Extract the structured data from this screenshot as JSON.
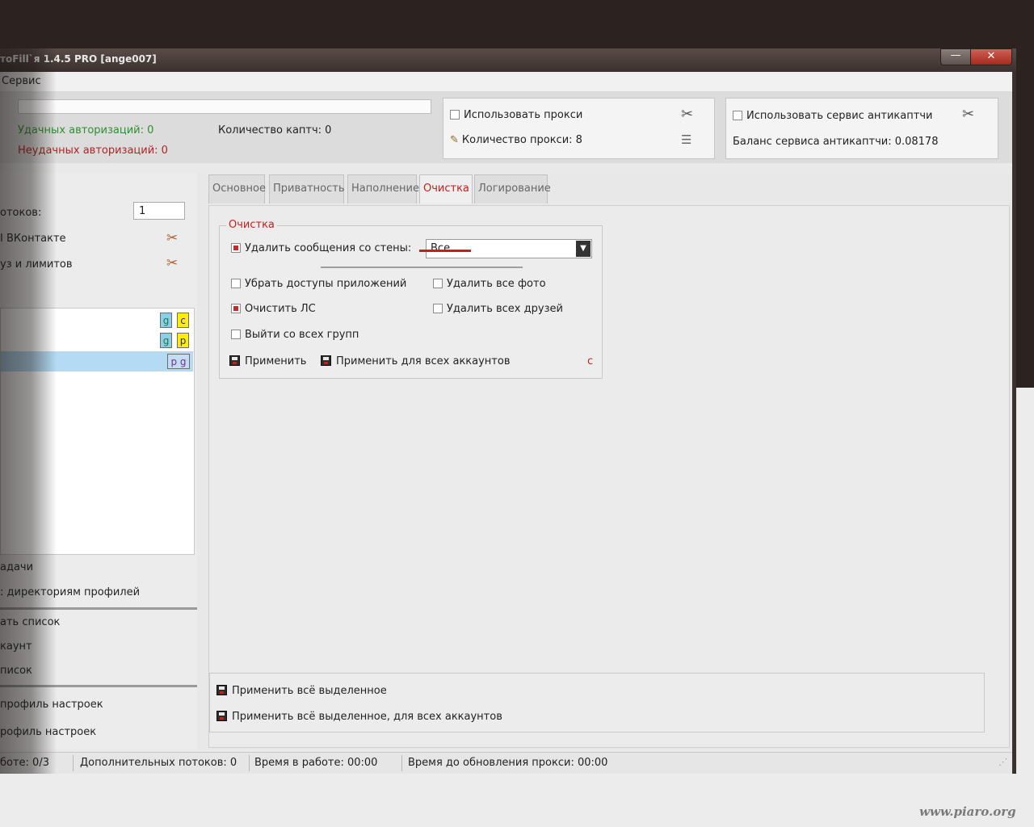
{
  "window": {
    "title": "тоFill`я 1.4.5 PRO [ange007]",
    "minimize_label": "—",
    "close_label": "✕"
  },
  "menu": {
    "service": "Сервис"
  },
  "topbar": {
    "success_auth": "Удачных авторизаций: 0",
    "fail_auth": "Неудачных авторизаций: 0",
    "captcha_count": "Количество каптч: 0",
    "proxy": {
      "use_label": "Использовать прокси",
      "use_checked": false,
      "count_label": "Количество прокси: 8"
    },
    "anticaptcha": {
      "use_label": "Использовать сервис антикаптчи",
      "use_checked": false,
      "balance_label": "Баланс сервиса антикаптчи: 0.08178"
    }
  },
  "sidebar": {
    "threads_label": "отоков:",
    "threads_value": "1",
    "vk_label": "І ВКонтакте",
    "limits_label": "уз и лимитов",
    "accounts": [
      {
        "tags": [
          "g",
          "c"
        ],
        "selected": false
      },
      {
        "tags": [
          "g",
          "p"
        ],
        "selected": false
      },
      {
        "tags": [
          "p g"
        ],
        "selected": true
      }
    ],
    "task_label": "адачи",
    "dirs_label": ": директориям профилей",
    "list_label": "ать список",
    "account_label": "каунт",
    "list2_label": "писок",
    "profile1_label": "профиль настроек",
    "profile2_label": "рофиль настроек"
  },
  "tabs": [
    {
      "label": "Основное",
      "active": false
    },
    {
      "label": "Приватность",
      "active": false
    },
    {
      "label": "Наполнение",
      "active": false
    },
    {
      "label": "Очистка",
      "active": true
    },
    {
      "label": "Логирование",
      "active": false
    }
  ],
  "cleanup": {
    "group_title": "Очистка",
    "delete_wall_label": "Удалить сообщения со стены:",
    "delete_wall_checked": true,
    "delete_wall_option": "Все",
    "remove_app_access_label": "Убрать доступы приложений",
    "remove_app_access_checked": false,
    "delete_photos_label": "Удалить все фото",
    "delete_photos_checked": false,
    "clear_pm_label": "Очистить ЛС",
    "clear_pm_checked": true,
    "delete_friends_label": "Удалить всех друзей",
    "delete_friends_checked": false,
    "leave_groups_label": "Выйти со всех групп",
    "leave_groups_checked": false,
    "apply_label": "Применить",
    "apply_all_label": "Применить для всех аккаунтов",
    "marker": "с"
  },
  "bottom_actions": {
    "apply_selected": "Применить всё выделенное",
    "apply_selected_all": "Применить всё выделенное, для всех аккаунтов"
  },
  "statusbar": {
    "in_work": "боте: 0/3",
    "extra_threads": "Дополнительных потоков: 0",
    "work_time": "Время в работе: 00:00",
    "proxy_update": "Время до обновления прокси: 00:00"
  },
  "watermark": "www.piaro.org"
}
